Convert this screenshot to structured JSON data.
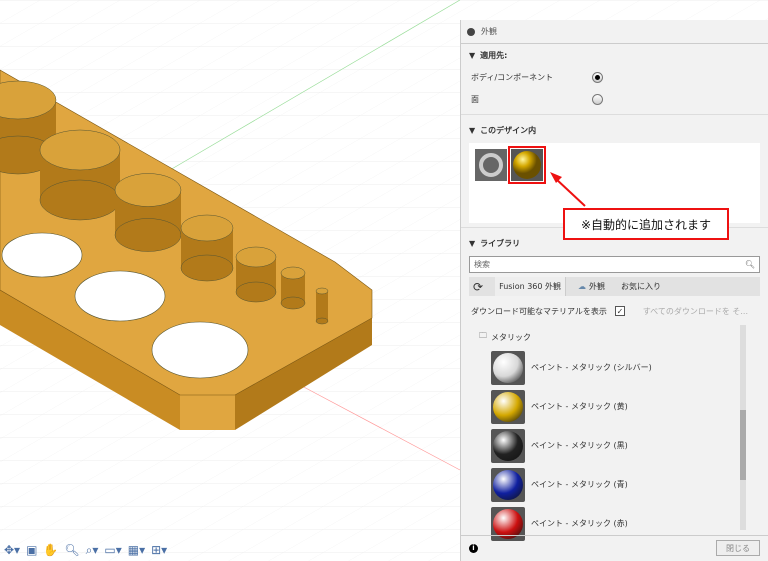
{
  "panel": {
    "title": "外観",
    "apply_to": "適用先:",
    "opt_body": "ボディ/コンポーネント",
    "opt_face": "面",
    "in_design": "このデザイン内",
    "library": "ライブラリ",
    "search_placeholder": "検索",
    "tabs": [
      "Fusion 360 外観",
      "外観",
      "お気に入り"
    ],
    "show_downloadable": "ダウンロード可能なマテリアルを表示",
    "download_all": "すべてのダウンロードを そ...",
    "folder": "メタリック",
    "items": [
      {
        "label": "ペイント - メタリック (シルバー)",
        "color": "#d8d8d8"
      },
      {
        "label": "ペイント - メタリック (黄)",
        "color": "#d4a800"
      },
      {
        "label": "ペイント - メタリック (黒)",
        "color": "#222222"
      },
      {
        "label": "ペイント - メタリック (青)",
        "color": "#1020a0"
      },
      {
        "label": "ペイント - メタリック (赤)",
        "color": "#cc1010"
      }
    ],
    "close": "閉じる",
    "info": "i"
  },
  "callout": "※自動的に追加されます",
  "model_color": "#d9a23a"
}
